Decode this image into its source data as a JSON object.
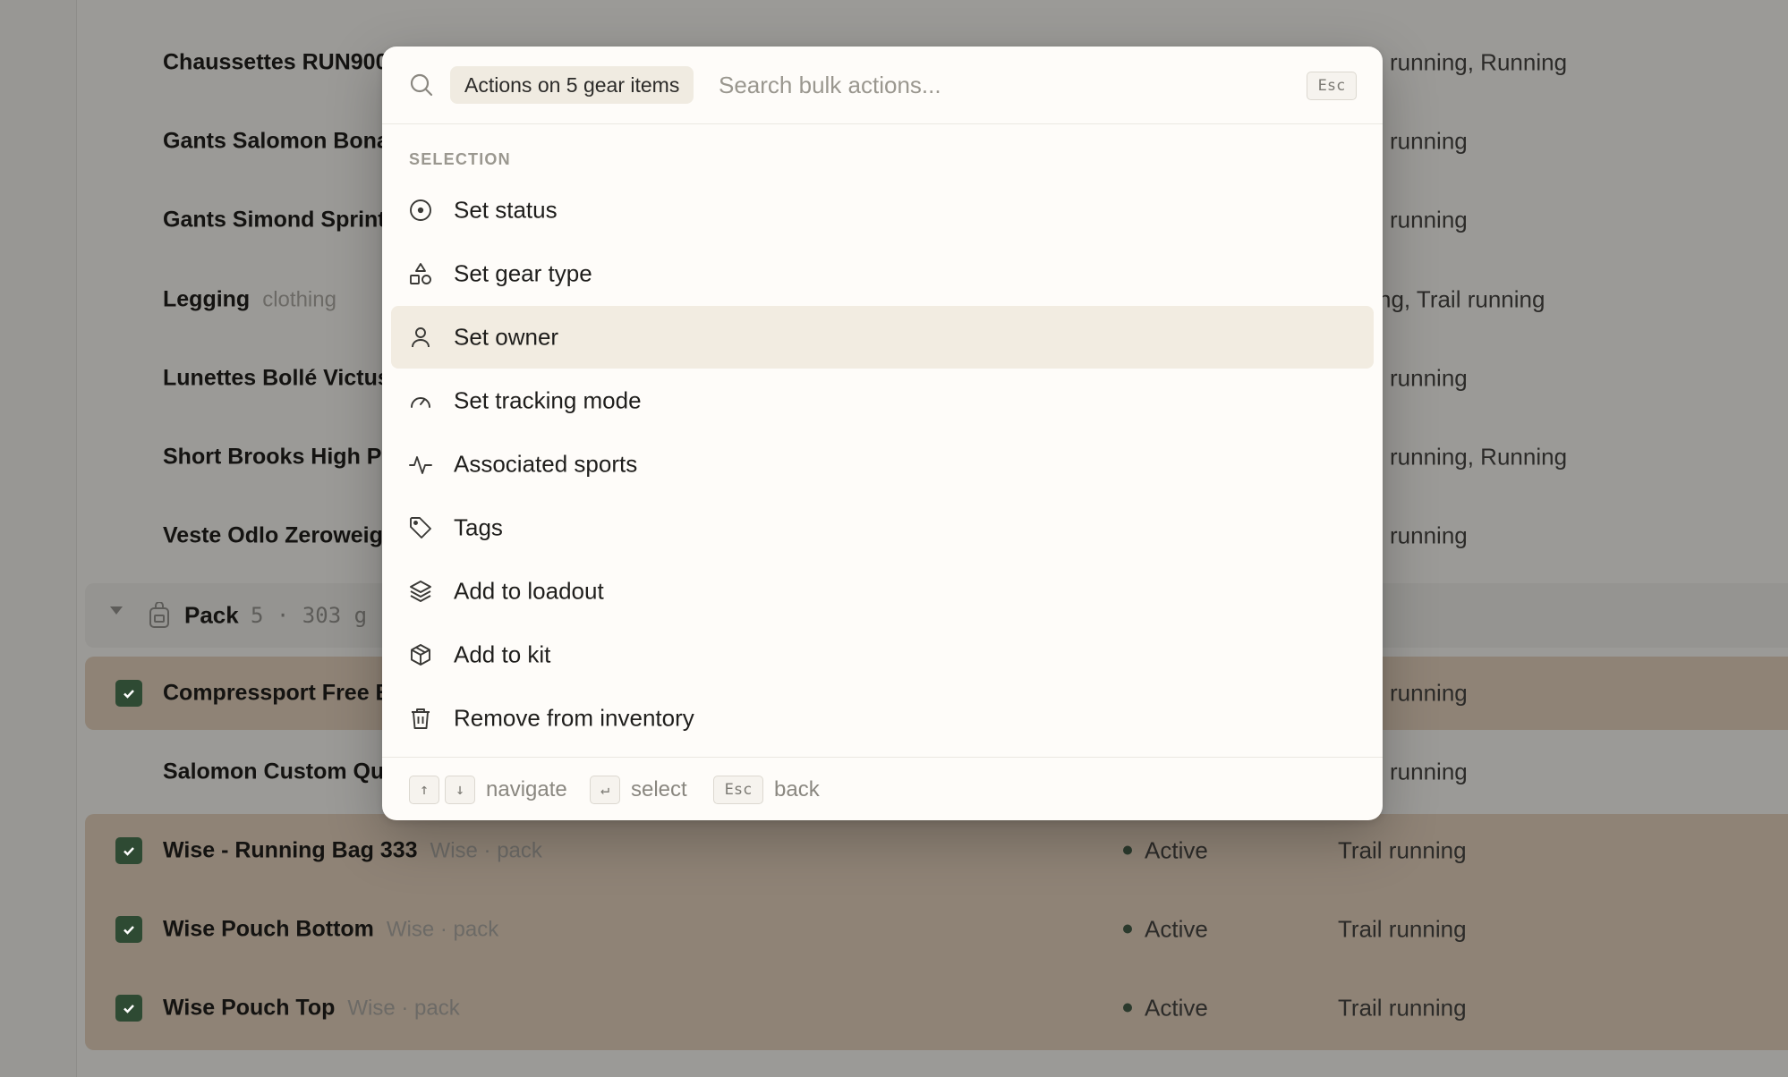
{
  "background": {
    "rows_top": [
      {
        "name": "Chaussettes RUN900",
        "meta": "",
        "sports": "running, Running"
      },
      {
        "name": "Gants Salomon Bonat",
        "meta": "",
        "sports": "running"
      },
      {
        "name": "Gants Simond Sprint",
        "meta": "",
        "sports": "running"
      },
      {
        "name": "Legging",
        "meta": "clothing",
        "sports": "ng, Trail running"
      },
      {
        "name": "Lunettes Bollé Victus",
        "meta": "",
        "sports": "running"
      },
      {
        "name": "Short Brooks High Po",
        "meta": "",
        "sports": "running, Running"
      },
      {
        "name": "Veste Odlo Zeroweigh",
        "meta": "",
        "sports": "running"
      }
    ],
    "group": {
      "name": "Pack",
      "meta": "5 · 303 g"
    },
    "rows_pack": [
      {
        "name": "Compressport Free B",
        "meta": "",
        "status": "",
        "sports": "running",
        "selected": true
      },
      {
        "name": "Salomon Custom Qui",
        "meta": "",
        "status": "",
        "sports": "running",
        "selected": false
      },
      {
        "name": "Wise - Running Bag 333",
        "meta": "Wise · pack",
        "status": "Active",
        "sports": "Trail running",
        "selected": true
      },
      {
        "name": "Wise Pouch Bottom",
        "meta": "Wise · pack",
        "status": "Active",
        "sports": "Trail running",
        "selected": true
      },
      {
        "name": "Wise Pouch Top",
        "meta": "Wise · pack",
        "status": "Active",
        "sports": "Trail running",
        "selected": true
      }
    ]
  },
  "palette": {
    "chip": "Actions on 5 gear items",
    "search_placeholder": "Search bulk actions...",
    "esc_key": "Esc",
    "section": "SELECTION",
    "items": [
      {
        "label": "Set status",
        "icon": "circle-dot-icon"
      },
      {
        "label": "Set gear type",
        "icon": "shapes-icon"
      },
      {
        "label": "Set owner",
        "icon": "user-icon",
        "active": true
      },
      {
        "label": "Set tracking mode",
        "icon": "gauge-icon"
      },
      {
        "label": "Associated sports",
        "icon": "activity-icon"
      },
      {
        "label": "Tags",
        "icon": "tag-icon"
      },
      {
        "label": "Add to loadout",
        "icon": "layers-icon"
      },
      {
        "label": "Add to kit",
        "icon": "package-icon"
      },
      {
        "label": "Remove from inventory",
        "icon": "trash-icon"
      }
    ],
    "footer": {
      "up_key": "↑",
      "down_key": "↓",
      "navigate": "navigate",
      "enter_key": "↵",
      "select": "select",
      "esc_key": "Esc",
      "back": "back"
    }
  }
}
